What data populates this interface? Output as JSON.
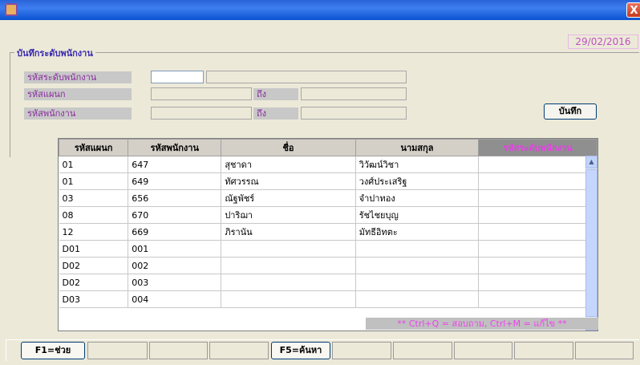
{
  "window": {
    "close_glyph": "X"
  },
  "date": "29/02/2016",
  "form": {
    "title": "บันทึกระดับพนักงาน",
    "level_label": "รหัสระดับพนักงาน",
    "dept_label": "รหัสแผนก",
    "emp_label": "รหัสพนักงาน",
    "to_label_1": "ถึง",
    "to_label_2": "ถึง",
    "save_label": "บันทึก"
  },
  "table": {
    "headers": [
      "รหัสแผนก",
      "รหัสพนักงาน",
      "ชื่อ",
      "นามสกุล",
      "รหัสระดับพนักงาน"
    ],
    "rows": [
      [
        "01",
        "647",
        "สุชาดา",
        "วิวัฒน์วิชา",
        ""
      ],
      [
        "01",
        "649",
        "ทัศวรรณ",
        "วงศ์ประเสริฐ",
        ""
      ],
      [
        "03",
        "656",
        "ณัฐพัชร์",
        "จำปาทอง",
        ""
      ],
      [
        "08",
        "670",
        "ปาริฌา",
        "รัชไชยบุญ",
        ""
      ],
      [
        "12",
        "669",
        "ภิรานัน",
        "มัทธีอิทตะ",
        ""
      ],
      [
        "D01",
        "001",
        "",
        "",
        ""
      ],
      [
        "D02",
        "002",
        "",
        "",
        ""
      ],
      [
        "D02",
        "003",
        "",
        "",
        ""
      ],
      [
        "D03",
        "004",
        "",
        "",
        ""
      ]
    ]
  },
  "hint": "**  Ctrl+Q = สอบถาม, Ctrl+M = แก้ไข  **",
  "fkeys": {
    "help": "F1=ช่วย",
    "search": "F5=ค้นหา"
  }
}
